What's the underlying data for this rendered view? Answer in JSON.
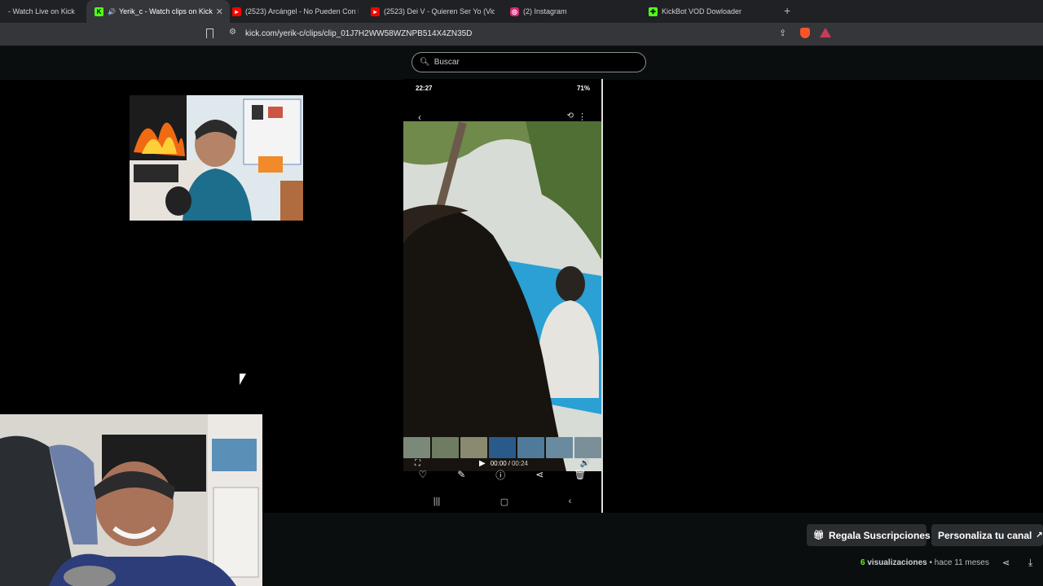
{
  "browser": {
    "tabs": [
      {
        "label": "- Watch Live on Kick",
        "icon": "kick-icon",
        "active": false
      },
      {
        "label": "Yerik_c - Watch clips on Kick",
        "icon": "kick-icon",
        "active": true
      },
      {
        "label": "(2523) Arcángel - No Pueden Con El",
        "icon": "youtube-icon",
        "active": false
      },
      {
        "label": "(2523) Dei V - Quieren Ser Yo (Video",
        "icon": "youtube-icon",
        "active": false
      },
      {
        "label": "(2) Instagram",
        "icon": "instagram-icon",
        "active": false
      },
      {
        "label": "KickBot VOD Dowloader",
        "icon": "extension-icon",
        "active": false
      }
    ],
    "new_tab": "+",
    "url": "kick.com/yerik-c/clips/clip_01J7H2WW58WZNPB514X4ZN35D"
  },
  "search": {
    "placeholder": "Buscar"
  },
  "phone": {
    "time": "22:27",
    "battery": "71%",
    "player_time": "00:00",
    "player_duration": "00:24"
  },
  "actions": {
    "gift_label": "Regala Suscripciones",
    "customize_label": "Personaliza tu canal"
  },
  "clip_meta": {
    "views_count": "6",
    "views_label": "visualizaciones",
    "separator": "•",
    "age": "hace 11 meses"
  },
  "colors": {
    "kick_green": "#53fc18",
    "youtube_red": "#ff0000",
    "background": "#000000"
  }
}
